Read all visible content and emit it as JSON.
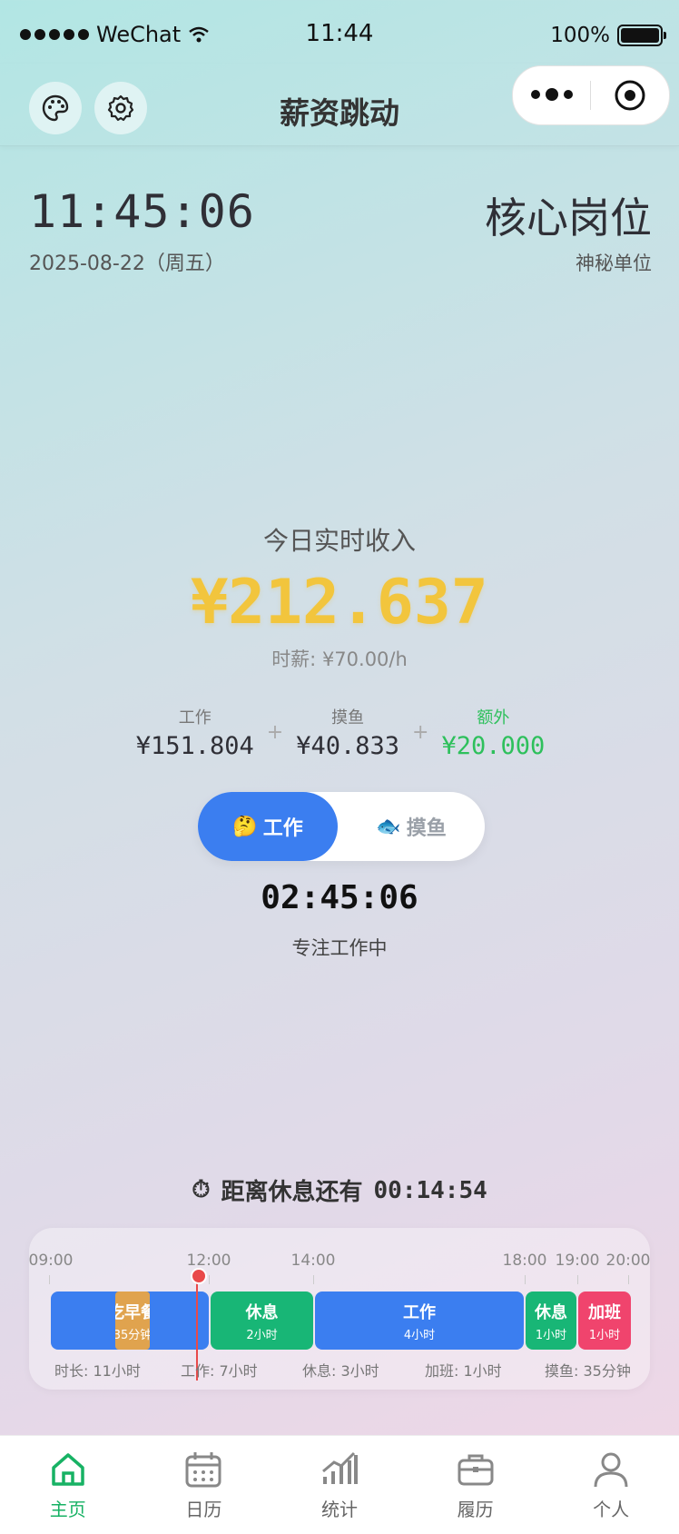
{
  "status_bar": {
    "carrier": "WeChat",
    "time": "11:44",
    "battery": "100%"
  },
  "nav": {
    "title": "薪资跳动"
  },
  "header": {
    "clock": "11:45:06",
    "date": "2025-08-22（周五）",
    "job_title": "核心岗位",
    "company": "神秘单位"
  },
  "income": {
    "label": "今日实时收入",
    "value": "¥212.637",
    "hourly": "时薪: ¥70.00/h",
    "breakdown": [
      {
        "label": "工作",
        "value": "¥151.804"
      },
      {
        "label": "摸鱼",
        "value": "¥40.833"
      },
      {
        "label": "额外",
        "value": "¥20.000"
      }
    ],
    "plus": "+"
  },
  "mode_toggle": {
    "work_label": "工作",
    "work_emoji": "🤔",
    "slack_label": "摸鱼",
    "slack_emoji": "🐟"
  },
  "timer": {
    "value": "02:45:06",
    "status": "专注工作中"
  },
  "countdown": {
    "icon": "⏱",
    "label": "距离休息还有",
    "value": "00:14:54"
  },
  "timeline": {
    "ticks": [
      "09:00",
      "12:00",
      "14:00",
      "18:00",
      "19:00",
      "20:00"
    ],
    "segments": [
      {
        "title": "工作",
        "sub": "",
        "color": "#3b7ef0"
      },
      {
        "title": "吃早餐",
        "sub": "35分钟",
        "color": "#e0a34e"
      },
      {
        "title": "休息",
        "sub": "2小时",
        "color": "#18b676"
      },
      {
        "title": "工作",
        "sub": "4小时",
        "color": "#3b7ef0"
      },
      {
        "title": "休息",
        "sub": "1小时",
        "color": "#18b676"
      },
      {
        "title": "加班",
        "sub": "1小时",
        "color": "#f0446d"
      }
    ],
    "stats": [
      "时长: 11小时",
      "工作: 7小时",
      "休息: 3小时",
      "加班: 1小时",
      "摸鱼: 35分钟"
    ]
  },
  "tabbar": {
    "active_color": "#17b264",
    "items": [
      {
        "label": "主页",
        "icon": "home-icon"
      },
      {
        "label": "日历",
        "icon": "calendar-icon"
      },
      {
        "label": "统计",
        "icon": "chart-icon"
      },
      {
        "label": "履历",
        "icon": "briefcase-icon"
      },
      {
        "label": "个人",
        "icon": "user-icon"
      }
    ]
  }
}
